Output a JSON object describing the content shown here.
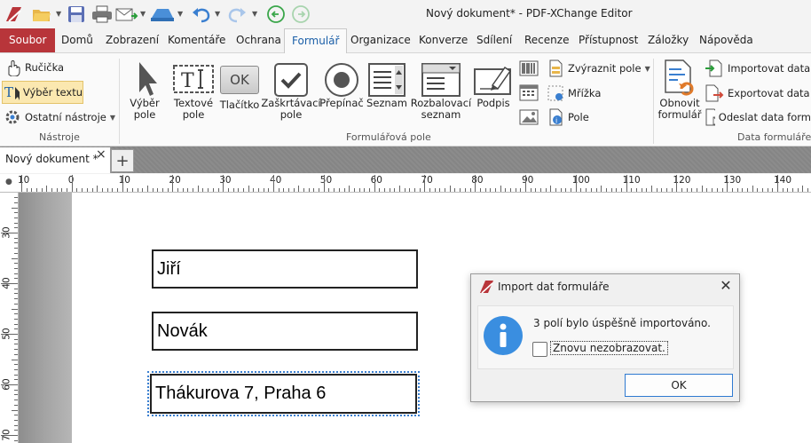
{
  "window": {
    "title": "Nový dokument* - PDF-XChange Editor"
  },
  "menu": {
    "items": [
      "Soubor",
      "Domů",
      "Zobrazení",
      "Komentáře",
      "Ochrana",
      "Formulář",
      "Organizace",
      "Konverze",
      "Sdílení",
      "Recenze",
      "Přístupnost",
      "Záložky",
      "Nápověda"
    ],
    "active": "Formulář"
  },
  "ribbon": {
    "tools": {
      "hand": "Ručička",
      "select_text": "Výběr textu",
      "other_tools": "Ostatní nástroje",
      "group": "Nástroje"
    },
    "form_fields": {
      "select_field": [
        "Výběr",
        "pole"
      ],
      "text_field": [
        "Textové",
        "pole"
      ],
      "button": [
        "Tlačítko"
      ],
      "button_icon_text": "OK",
      "checkbox": [
        "Zaškrtávací",
        "pole"
      ],
      "radio": [
        "Přepínač"
      ],
      "list": [
        "Seznam"
      ],
      "dropdown": [
        "Rozbalovací",
        "seznam"
      ],
      "signature": [
        "Podpis"
      ],
      "highlight_fields": "Zvýraznit pole",
      "grid": "Mřížka",
      "fields": "Pole",
      "group": "Formulářová pole"
    },
    "form_data": {
      "reset_form": [
        "Obnovit",
        "formulář"
      ],
      "import": "Importovat data",
      "export": "Exportovat data",
      "submit": "Odeslat data form",
      "group": "Data formuláře"
    }
  },
  "tabs": {
    "doc": "Nový dokument *",
    "close": "×",
    "new": "+"
  },
  "ruler": {
    "h_labels": [
      "10",
      "0",
      "10",
      "20",
      "30",
      "40",
      "50",
      "60",
      "70",
      "80",
      "90",
      "100",
      "110",
      "120",
      "130",
      "140"
    ],
    "v_labels": [
      "30",
      "40",
      "50",
      "60",
      "70"
    ]
  },
  "document": {
    "fields": [
      "Jiří",
      "Novák",
      "Thákurova 7, Praha 6"
    ]
  },
  "dialog": {
    "title": "Import dat formuláře",
    "close": "✕",
    "message": "3 polí bylo úspěšně importováno.",
    "checkbox_label": "Znovu nezobrazovat.",
    "ok": "OK"
  },
  "colors": {
    "accent_red": "#b8353a",
    "accent_blue": "#1b5fa8",
    "info_blue": "#3a8ee0"
  }
}
